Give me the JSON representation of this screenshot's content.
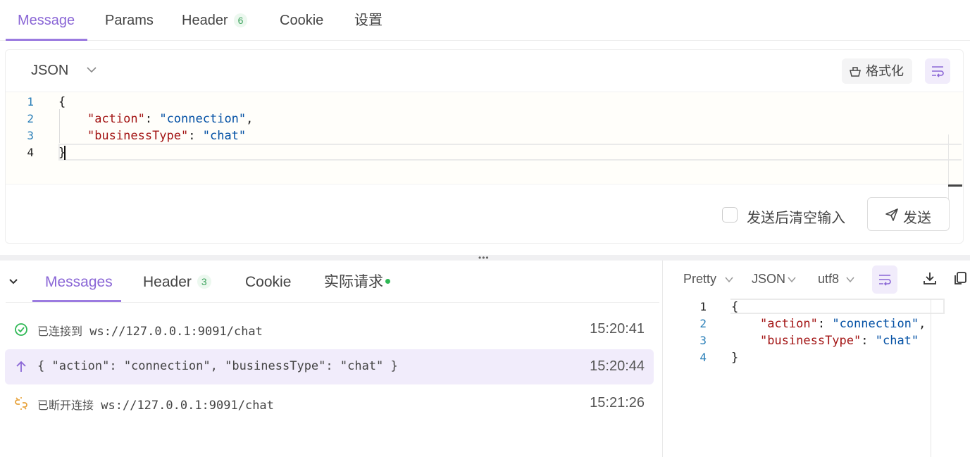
{
  "top_tabs": [
    {
      "label": "Message",
      "active": true
    },
    {
      "label": "Params"
    },
    {
      "label": "Header",
      "badge": "6"
    },
    {
      "label": "Cookie"
    },
    {
      "label": "设置"
    }
  ],
  "editor": {
    "language": "JSON",
    "format_label": "格式化",
    "lines": [
      {
        "num": "1"
      },
      {
        "num": "2",
        "key": "\"action\"",
        "value": "\"connection\""
      },
      {
        "num": "3",
        "key": "\"businessType\"",
        "value": "\"chat\""
      },
      {
        "num": "4"
      }
    ],
    "open_brace": "{",
    "close_brace": "}",
    "clear_after_send_label": "发送后清空输入",
    "send_label": "发送"
  },
  "bottom_tabs": [
    {
      "label": "Messages",
      "active": true
    },
    {
      "label": "Header",
      "badge": "3"
    },
    {
      "label": "Cookie"
    },
    {
      "label": "实际请求",
      "dot": true
    }
  ],
  "messages": [
    {
      "type": "connected",
      "prefix": "已连接到",
      "text": "ws://127.0.0.1:9091/chat",
      "time": "15:20:41"
    },
    {
      "type": "sent",
      "text": "{ \"action\": \"connection\", \"businessType\": \"chat\" }",
      "time": "15:20:44"
    },
    {
      "type": "disconnected",
      "prefix": "已断开连接",
      "text": "ws://127.0.0.1:9091/chat",
      "time": "15:21:26"
    }
  ],
  "preview": {
    "view_mode": "Pretty",
    "format": "JSON",
    "encoding": "utf8",
    "lines": [
      {
        "num": "1"
      },
      {
        "num": "2",
        "key": "\"action\"",
        "value": "\"connection\""
      },
      {
        "num": "3",
        "key": "\"businessType\"",
        "value": "\"chat\""
      },
      {
        "num": "4"
      }
    ],
    "open_brace": "{",
    "close_brace": "}"
  },
  "colors": {
    "accent": "#8a66d6",
    "accent_bg": "#f1ecfb",
    "json_key": "#a31515",
    "json_string": "#0451a5",
    "success": "#2fb855",
    "warning": "#e8a33c"
  },
  "icons": [
    "chevron-down-icon",
    "broom-icon",
    "wrap-lines-icon",
    "send-plane-icon",
    "collapse-chevron-icon",
    "check-circle-icon",
    "arrow-up-icon",
    "broken-link-icon",
    "download-icon",
    "copy-icon"
  ]
}
